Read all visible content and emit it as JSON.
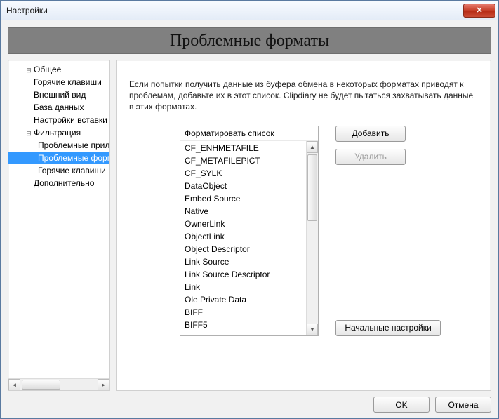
{
  "window": {
    "title": "Настройки",
    "close_icon": "✕"
  },
  "banner": "Проблемные форматы",
  "tree": {
    "items": [
      {
        "label": "Общее",
        "level": 1,
        "hasChildren": false
      },
      {
        "label": "Горячие клавиши",
        "level": 1,
        "hasChildren": false
      },
      {
        "label": "Внешний вид",
        "level": 1,
        "hasChildren": false
      },
      {
        "label": "База данных",
        "level": 1,
        "hasChildren": false
      },
      {
        "label": "Настройки вставки",
        "level": 1,
        "hasChildren": false
      },
      {
        "label": "Фильтрация",
        "level": 1,
        "hasChildren": true,
        "expanded": true
      },
      {
        "label": "Проблемные приложения",
        "level": 2,
        "hasChildren": false
      },
      {
        "label": "Проблемные форматы",
        "level": 2,
        "hasChildren": false,
        "selected": true
      },
      {
        "label": "Горячие клавиши",
        "level": 2,
        "hasChildren": false
      },
      {
        "label": "Дополнительно",
        "level": 1,
        "hasChildren": false
      }
    ],
    "root_expanded_glyph": "⊟",
    "child_expanded_glyph": "⊟",
    "leaf_glyph": ""
  },
  "main": {
    "description": "Если попытки получить данные из буфера обмена в некоторых форматах  приводят к проблемам, добавьте их в этот список. Clipdiary не будет пытаться захватывать данные в этих форматах.",
    "list_header": "Форматировать список",
    "formats": [
      "CF_ENHMETAFILE",
      "CF_METAFILEPICT",
      "CF_SYLK",
      "DataObject",
      "Embed Source",
      "Native",
      "OwnerLink",
      "ObjectLink",
      "Object Descriptor",
      "Link Source",
      "Link Source Descriptor",
      "Link",
      "Ole Private Data",
      "BIFF",
      "BIFF5"
    ],
    "buttons": {
      "add": "Добавить",
      "remove": "Удалить",
      "defaults": "Начальные настройки"
    }
  },
  "footer": {
    "ok": "OK",
    "cancel": "Отмена"
  },
  "scroll_glyphs": {
    "left": "◄",
    "right": "►",
    "up": "▲",
    "down": "▼"
  }
}
